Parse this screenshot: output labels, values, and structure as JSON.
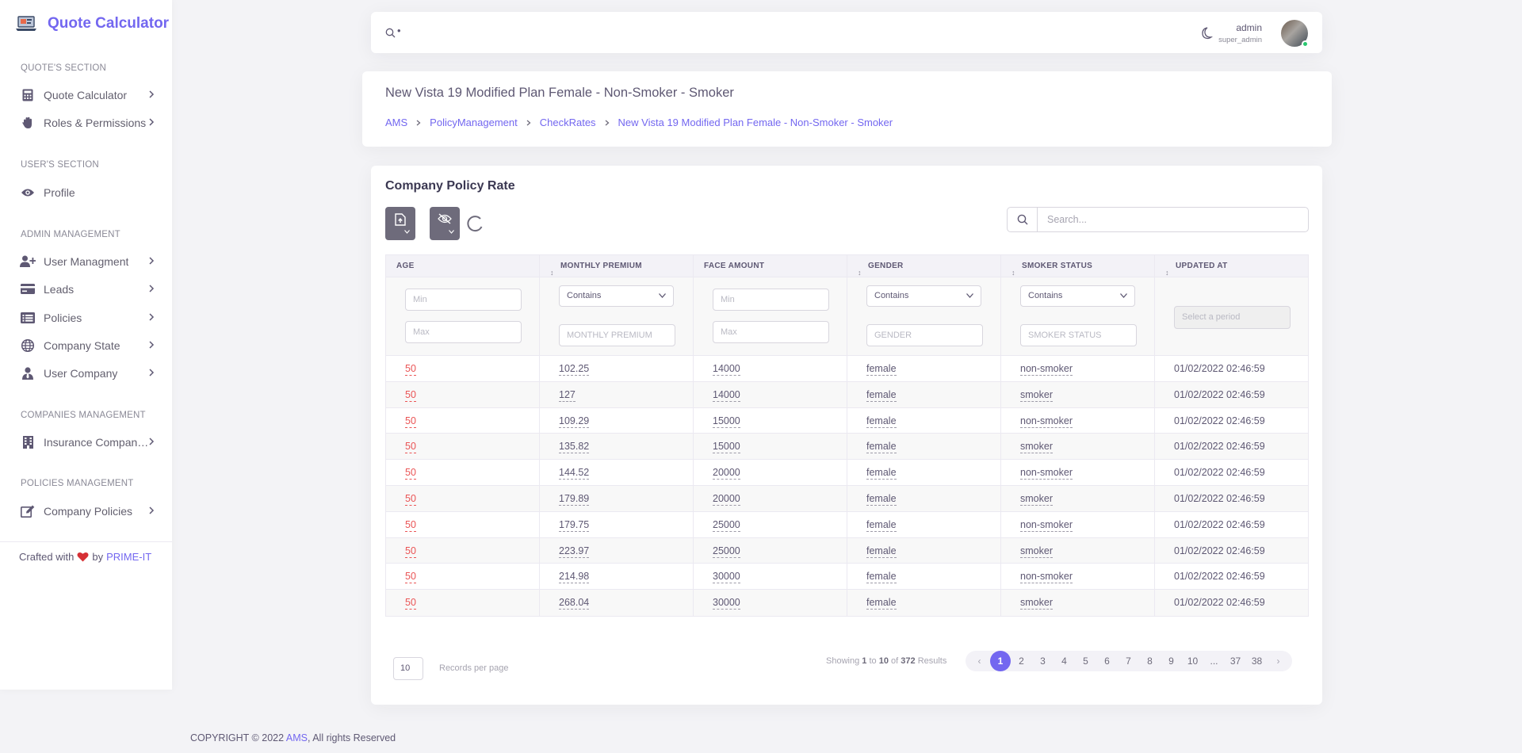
{
  "brand": {
    "title": "Quote Calculator"
  },
  "sidebar": {
    "sections": [
      {
        "title": "QUOTE'S SECTION",
        "items": [
          {
            "label": "Quote Calculator",
            "icon": "calculator-icon"
          },
          {
            "label": "Roles & Permissions",
            "icon": "hand-icon"
          }
        ]
      },
      {
        "title": "USER'S SECTION",
        "items": [
          {
            "label": "Profile",
            "icon": "eye-icon"
          }
        ]
      },
      {
        "title": "ADMIN MANAGEMENT",
        "items": [
          {
            "label": "User Managment",
            "icon": "user-plus-icon"
          },
          {
            "label": "Leads",
            "icon": "credit-card-icon"
          },
          {
            "label": "Policies",
            "icon": "list-icon"
          },
          {
            "label": "Company State",
            "icon": "globe-icon"
          },
          {
            "label": "User Company",
            "icon": "user-tie-icon"
          }
        ]
      },
      {
        "title": "COMPANIES MANAGEMENT",
        "items": [
          {
            "label": "Insurance Companies",
            "icon": "building-icon"
          }
        ]
      },
      {
        "title": "POLICIES MANAGEMENT",
        "items": [
          {
            "label": "Company Policies",
            "icon": "edit-icon"
          }
        ]
      }
    ],
    "crafted_prefix": "Crafted with",
    "crafted_by": "by",
    "crafted_company": "PRIME-IT"
  },
  "topbar": {
    "search_value": "•",
    "username": "admin",
    "role": "super_admin"
  },
  "header": {
    "title": "New Vista 19 Modified Plan Female - Non-Smoker - Smoker",
    "breadcrumbs": [
      "AMS",
      "PolicyManagement",
      "CheckRates",
      "New Vista 19 Modified Plan Female - Non-Smoker - Smoker"
    ]
  },
  "card": {
    "title": "Company Policy Rate",
    "search_placeholder": "Search..."
  },
  "table": {
    "columns": [
      "AGE",
      "MONTHLY PREMIUM",
      "FACE AMOUNT",
      "GENDER",
      "SMOKER STATUS",
      "UPDATED AT"
    ],
    "filters": {
      "min": "Min",
      "max": "Max",
      "contains": "Contains",
      "monthly_premium": "MONTHLY PREMIUM",
      "gender": "GENDER",
      "smoker_status": "SMOKER STATUS",
      "period": "Select a period"
    },
    "rows": [
      [
        "50",
        "102.25",
        "14000",
        "female",
        "non-smoker",
        "01/02/2022 02:46:59"
      ],
      [
        "50",
        "127",
        "14000",
        "female",
        "smoker",
        "01/02/2022 02:46:59"
      ],
      [
        "50",
        "109.29",
        "15000",
        "female",
        "non-smoker",
        "01/02/2022 02:46:59"
      ],
      [
        "50",
        "135.82",
        "15000",
        "female",
        "smoker",
        "01/02/2022 02:46:59"
      ],
      [
        "50",
        "144.52",
        "20000",
        "female",
        "non-smoker",
        "01/02/2022 02:46:59"
      ],
      [
        "50",
        "179.89",
        "20000",
        "female",
        "smoker",
        "01/02/2022 02:46:59"
      ],
      [
        "50",
        "179.75",
        "25000",
        "female",
        "non-smoker",
        "01/02/2022 02:46:59"
      ],
      [
        "50",
        "223.97",
        "25000",
        "female",
        "smoker",
        "01/02/2022 02:46:59"
      ],
      [
        "50",
        "214.98",
        "30000",
        "female",
        "non-smoker",
        "01/02/2022 02:46:59"
      ],
      [
        "50",
        "268.04",
        "30000",
        "female",
        "smoker",
        "01/02/2022 02:46:59"
      ]
    ]
  },
  "pagination": {
    "per_page": "10",
    "per_page_label": "Records per page",
    "showing_prefix": "Showing",
    "from": "1",
    "to_word": "to",
    "to": "10",
    "of_word": "of",
    "total": "372",
    "results_word": "Results",
    "prev": "‹",
    "next": "›",
    "pages": [
      "1",
      "2",
      "3",
      "4",
      "5",
      "6",
      "7",
      "8",
      "9",
      "10",
      "...",
      "37",
      "38"
    ],
    "active_page": "1"
  },
  "footer": {
    "copyright_prefix": "COPYRIGHT © 2022",
    "company": "AMS",
    "suffix": ", All rights Reserved"
  },
  "colors": {
    "accent": "#7367f0",
    "danger": "#ea5455",
    "success": "#28c76f",
    "muted_button": "#6e6b7b"
  }
}
